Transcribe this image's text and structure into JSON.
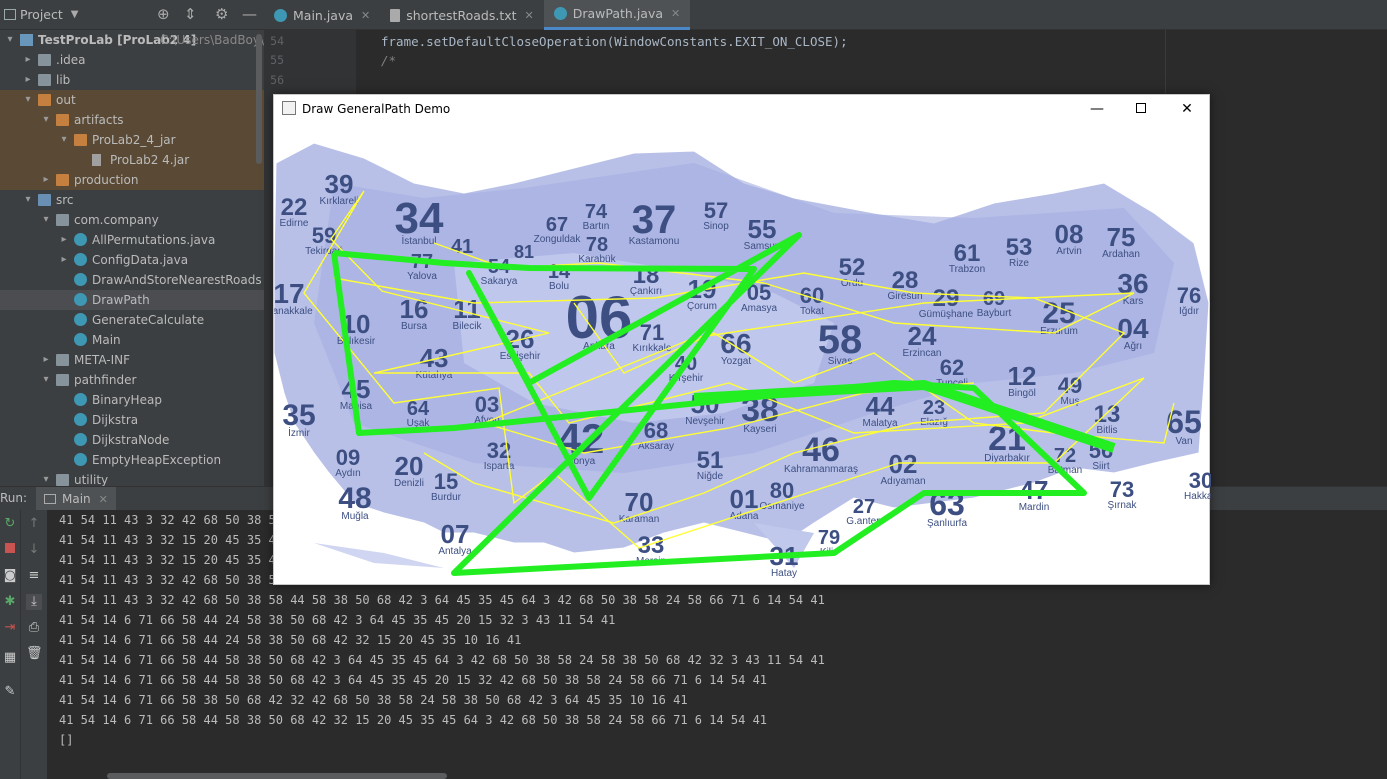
{
  "project": {
    "title": "Project",
    "tree": [
      {
        "label": "TestProLab [ProLab2 4]",
        "extra": "C:\\Users\\BadBoy\\De",
        "depth": 0,
        "arrow": "▾",
        "icon": "module"
      },
      {
        "label": ".idea",
        "depth": 1,
        "arrow": "▸",
        "icon": "folder"
      },
      {
        "label": "lib",
        "depth": 1,
        "arrow": "▸",
        "icon": "folder"
      },
      {
        "label": "out",
        "depth": 1,
        "arrow": "▾",
        "icon": "folder-orange"
      },
      {
        "label": "artifacts",
        "depth": 2,
        "arrow": "▾",
        "icon": "folder-orange"
      },
      {
        "label": "ProLab2_4_jar",
        "depth": 3,
        "arrow": "▾",
        "icon": "folder-orange"
      },
      {
        "label": "ProLab2 4.jar",
        "depth": 4,
        "arrow": "",
        "icon": "jar"
      },
      {
        "label": "production",
        "depth": 2,
        "arrow": "▸",
        "icon": "folder-orange"
      },
      {
        "label": "src",
        "depth": 1,
        "arrow": "▾",
        "icon": "folder-blue"
      },
      {
        "label": "com.company",
        "depth": 2,
        "arrow": "▾",
        "icon": "folder"
      },
      {
        "label": "AllPermutations.java",
        "depth": 3,
        "arrow": "▸",
        "icon": "class"
      },
      {
        "label": "ConfigData.java",
        "depth": 3,
        "arrow": "▸",
        "icon": "class"
      },
      {
        "label": "DrawAndStoreNearestRoads",
        "depth": 3,
        "arrow": "",
        "icon": "class"
      },
      {
        "label": "DrawPath",
        "depth": 3,
        "arrow": "",
        "icon": "class"
      },
      {
        "label": "GenerateCalculate",
        "depth": 3,
        "arrow": "",
        "icon": "class"
      },
      {
        "label": "Main",
        "depth": 3,
        "arrow": "",
        "icon": "class"
      },
      {
        "label": "META-INF",
        "depth": 2,
        "arrow": "▸",
        "icon": "folder"
      },
      {
        "label": "pathfinder",
        "depth": 2,
        "arrow": "▾",
        "icon": "folder"
      },
      {
        "label": "BinaryHeap",
        "depth": 3,
        "arrow": "",
        "icon": "class"
      },
      {
        "label": "Dijkstra",
        "depth": 3,
        "arrow": "",
        "icon": "class"
      },
      {
        "label": "DijkstraNode",
        "depth": 3,
        "arrow": "",
        "icon": "class"
      },
      {
        "label": "EmptyHeapException",
        "depth": 3,
        "arrow": "",
        "icon": "class"
      },
      {
        "label": "utility",
        "depth": 2,
        "arrow": "▾",
        "icon": "folder"
      }
    ]
  },
  "editor": {
    "tabs": [
      {
        "label": "Main.java",
        "icon": "class"
      },
      {
        "label": "shortestRoads.txt",
        "icon": "text"
      },
      {
        "label": "DrawPath.java",
        "icon": "class",
        "active": true
      }
    ],
    "lines": [
      {
        "num": "54",
        "code": "frame.setDefaultCloseOperation(WindowConstants.EXIT_ON_CLOSE);"
      },
      {
        "num": "55",
        "code": "/*"
      },
      {
        "num": "56",
        "code": ""
      }
    ]
  },
  "run": {
    "label": "Run:",
    "tab": "Main",
    "output": [
      "41 54 11 43 3 32 42 68 50 38 58",
      "41 54 11 43 3 32 15 20 45 35 45",
      "41 54 11 43 3 32 15 20 45 35 45",
      "41 54 11 43 3 32 42 68 50 38 58",
      "41 54 11 43 3 32 42 68 50 38 58 44 58 38 50 68 42 3 64 45 35 45 64 3 42 68 50 38 58 24 58 66 71 6 14 54 41",
      "41 54 14 6 71 66 58 44 24 58 38 50 68 42 3 64 45 35 45 20 15 32 3 43 11 54 41",
      "41 54 14 6 71 66 58 44 24 58 38 50 68 42 32 15 20 45 35 10 16 41",
      "41 54 14 6 71 66 58 44 58 38 50 68 42 3 64 45 35 45 64 3 42 68 50 38 58 24 58 38 50 68 42 32 3 43 11 54 41",
      "41 54 14 6 71 66 58 44 58 38 50 68 42 3 64 45 35 45 20 15 32 42 68 50 38 58 24 58 66 71 6 14 54 41",
      "41 54 14 6 71 66 58 38 50 68 42 32 42 68 50 38 58 24 58 38 50 68 42 3 64 45 35 10 16 41",
      "41 54 14 6 71 66 58 44 58 38 50 68 42 32 15 20 45 35 45 64 3 42 68 50 38 58 24 58 66 71 6 14 54 41",
      "[]"
    ]
  },
  "window": {
    "title": "Draw GeneralPath Demo",
    "provinces": [
      {
        "code": "39",
        "name": "Kırklareli"
      },
      {
        "code": "22",
        "name": "Edirne"
      },
      {
        "code": "34",
        "name": "İstanbul"
      },
      {
        "code": "59",
        "name": "Tekirdağ"
      },
      {
        "code": "41",
        "name": ""
      },
      {
        "code": "81",
        "name": ""
      },
      {
        "code": "67",
        "name": "Zonguldak"
      },
      {
        "code": "74",
        "name": "Bartın"
      },
      {
        "code": "78",
        "name": "Karabük"
      },
      {
        "code": "37",
        "name": "Kastamonu"
      },
      {
        "code": "57",
        "name": "Sinop"
      },
      {
        "code": "55",
        "name": "Samsun"
      },
      {
        "code": "52",
        "name": "Ordu"
      },
      {
        "code": "61",
        "name": "Trabzon"
      },
      {
        "code": "53",
        "name": "Rize"
      },
      {
        "code": "08",
        "name": "Artvin"
      },
      {
        "code": "75",
        "name": "Ardahan"
      },
      {
        "code": "17",
        "name": "Çanakkale"
      },
      {
        "code": "77",
        "name": "Yalova"
      },
      {
        "code": "54",
        "name": "Sakarya"
      },
      {
        "code": "14",
        "name": "Bolu"
      },
      {
        "code": "18",
        "name": "Çankırı"
      },
      {
        "code": "19",
        "name": "Çorum"
      },
      {
        "code": "05",
        "name": "Amasya"
      },
      {
        "code": "60",
        "name": "Tokat"
      },
      {
        "code": "28",
        "name": "Giresun"
      },
      {
        "code": "29",
        "name": "Gümüşhane"
      },
      {
        "code": "69",
        "name": "Bayburt"
      },
      {
        "code": "36",
        "name": "Kars"
      },
      {
        "code": "76",
        "name": "Iğdır"
      },
      {
        "code": "16",
        "name": "Bursa"
      },
      {
        "code": "11",
        "name": "Bilecik"
      },
      {
        "code": "10",
        "name": "Balıkesir"
      },
      {
        "code": "26",
        "name": "Eskişehir"
      },
      {
        "code": "06",
        "name": "Ankara"
      },
      {
        "code": "71",
        "name": "Kırıkkale"
      },
      {
        "code": "66",
        "name": "Yozgat"
      },
      {
        "code": "58",
        "name": "Sivas"
      },
      {
        "code": "24",
        "name": "Erzincan"
      },
      {
        "code": "25",
        "name": "Erzurum"
      },
      {
        "code": "04",
        "name": "Ağrı"
      },
      {
        "code": "43",
        "name": "Kütahya"
      },
      {
        "code": "45",
        "name": "Manisa"
      },
      {
        "code": "40",
        "name": "Kırşehir"
      },
      {
        "code": "62",
        "name": "Tunceli"
      },
      {
        "code": "12",
        "name": "Bingöl"
      },
      {
        "code": "49",
        "name": "Muş"
      },
      {
        "code": "35",
        "name": "İzmir"
      },
      {
        "code": "64",
        "name": "Uşak"
      },
      {
        "code": "03",
        "name": "Afyon"
      },
      {
        "code": "50",
        "name": "Nevşehir"
      },
      {
        "code": "38",
        "name": "Kayseri"
      },
      {
        "code": "44",
        "name": "Malatya"
      },
      {
        "code": "23",
        "name": "Elazığ"
      },
      {
        "code": "13",
        "name": "Bitlis"
      },
      {
        "code": "65",
        "name": "Van"
      },
      {
        "code": "09",
        "name": "Aydın"
      },
      {
        "code": "20",
        "name": "Denizli"
      },
      {
        "code": "32",
        "name": "Isparta"
      },
      {
        "code": "42",
        "name": "Konya"
      },
      {
        "code": "68",
        "name": "Aksaray"
      },
      {
        "code": "51",
        "name": "Niğde"
      },
      {
        "code": "46",
        "name": "Kahramanmaraş"
      },
      {
        "code": "21",
        "name": "Diyarbakır"
      },
      {
        "code": "72",
        "name": "Batman"
      },
      {
        "code": "56",
        "name": "Siirt"
      },
      {
        "code": "48",
        "name": "Muğla"
      },
      {
        "code": "15",
        "name": "Burdur"
      },
      {
        "code": "70",
        "name": "Karaman"
      },
      {
        "code": "01",
        "name": "Adana"
      },
      {
        "code": "80",
        "name": "Osmaniye"
      },
      {
        "code": "02",
        "name": "Adıyaman"
      },
      {
        "code": "47",
        "name": "Mardin"
      },
      {
        "code": "73",
        "name": "Şırnak"
      },
      {
        "code": "30",
        "name": "Hakkari"
      },
      {
        "code": "07",
        "name": "Antalya"
      },
      {
        "code": "33",
        "name": "Mersin"
      },
      {
        "code": "27",
        "name": "G.antep"
      },
      {
        "code": "63",
        "name": "Şanlıurfa"
      },
      {
        "code": "79",
        "name": "Kilis"
      },
      {
        "code": "31",
        "name": "Hatay"
      }
    ]
  }
}
